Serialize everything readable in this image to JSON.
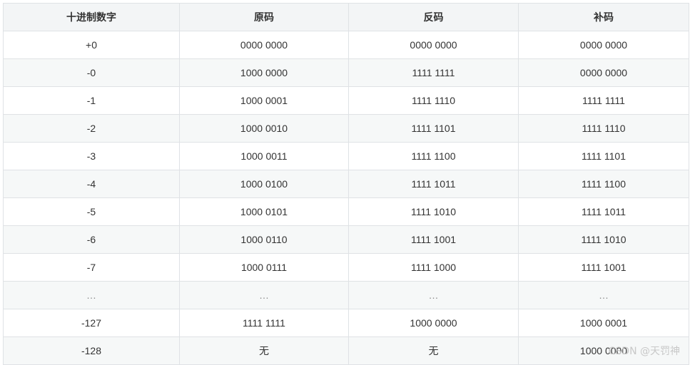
{
  "table": {
    "headers": [
      "十进制数字",
      "原码",
      "反码",
      "补码"
    ],
    "rows": [
      [
        "+0",
        "0000 0000",
        "0000 0000",
        "0000 0000"
      ],
      [
        "-0",
        "1000 0000",
        "1111 1111",
        "0000 0000"
      ],
      [
        "-1",
        "1000 0001",
        "1111 1110",
        "1111 1111"
      ],
      [
        "-2",
        "1000 0010",
        "1111 1101",
        "1111 1110"
      ],
      [
        "-3",
        "1000 0011",
        "1111 1100",
        "1111 1101"
      ],
      [
        "-4",
        "1000 0100",
        "1111 1011",
        "1111 1100"
      ],
      [
        "-5",
        "1000 0101",
        "1111 1010",
        "1111 1011"
      ],
      [
        "-6",
        "1000 0110",
        "1111 1001",
        "1111 1010"
      ],
      [
        "-7",
        "1000 0111",
        "1111 1000",
        "1111 1001"
      ],
      [
        "…",
        "…",
        "…",
        "…"
      ],
      [
        "-127",
        "1111 1111",
        "1000 0000",
        "1000 0001"
      ],
      [
        "-128",
        "无",
        "无",
        "1000 0000"
      ]
    ]
  },
  "watermark": "CSDN @天罚神"
}
